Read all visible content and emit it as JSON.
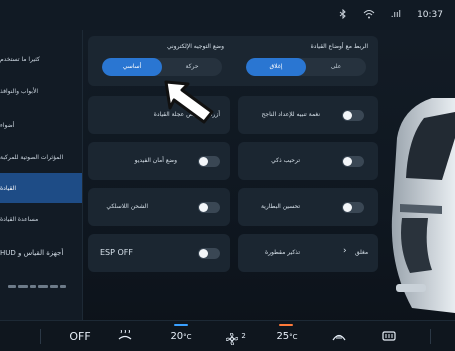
{
  "status": {
    "bluetooth_icon": "bluetooth-icon",
    "wifi_icon": "wifi-icon",
    "signal_text": ".ııl",
    "time": "10:37"
  },
  "sidebar": {
    "items": [
      {
        "label": "كثيرا ما تستخدم",
        "active": false
      },
      {
        "label": "الأبواب والنوافذ",
        "active": false
      },
      {
        "label": "أضواء",
        "active": false
      },
      {
        "label": "المؤثرات الصوتية للمركبة",
        "active": false
      },
      {
        "label": "القيادة",
        "active": true
      },
      {
        "label": "مساعدة القيادة",
        "active": false
      },
      {
        "label": "أجهزة القياس و HUD",
        "active": false
      }
    ],
    "logo": "brand-logo"
  },
  "steering_mode": {
    "title": "وضع التوجيه الإلكتروني",
    "options": [
      {
        "label": "حركة"
      },
      {
        "label": "أساسي"
      }
    ],
    "selected": "أساسي"
  },
  "drive_link": {
    "title": "الربط مع أوضاع القيادة",
    "options": [
      {
        "label": "على"
      },
      {
        "label": "إغلاق"
      }
    ],
    "selected": "إغلاق"
  },
  "settings": [
    {
      "key": "wheel_buttons",
      "label": "أزرار تخصيص عجلة القيادة",
      "type": "link"
    },
    {
      "key": "reset_sound",
      "label": "نغمة تنبيه للإعداد الناجح",
      "type": "toggle",
      "on": false
    },
    {
      "key": "video_safe",
      "label": "وضع أمان الفيديو",
      "type": "toggle",
      "on": false
    },
    {
      "key": "smart_welcome",
      "label": "ترحيب ذكي",
      "type": "toggle",
      "on": false
    },
    {
      "key": "wireless_charging",
      "label": "الشحن اللاسلكي",
      "type": "toggle",
      "on": false
    },
    {
      "key": "battery_improve",
      "label": "تحسين البطارية",
      "type": "toggle",
      "on": false
    },
    {
      "key": "esp",
      "label": "ESP OFF",
      "type": "toggle",
      "on": false
    },
    {
      "key": "ticket_reminder",
      "label": "تذكير مقطورة",
      "value": "مغلق",
      "type": "link"
    }
  ],
  "bottom_bar": {
    "off_label": "OFF",
    "left_temp": "20",
    "right_temp": "25",
    "temp_unit": "°C",
    "fan_level": "2",
    "left_temp_color": "#3aa0ff",
    "right_temp_color": "#ff7a3a"
  }
}
